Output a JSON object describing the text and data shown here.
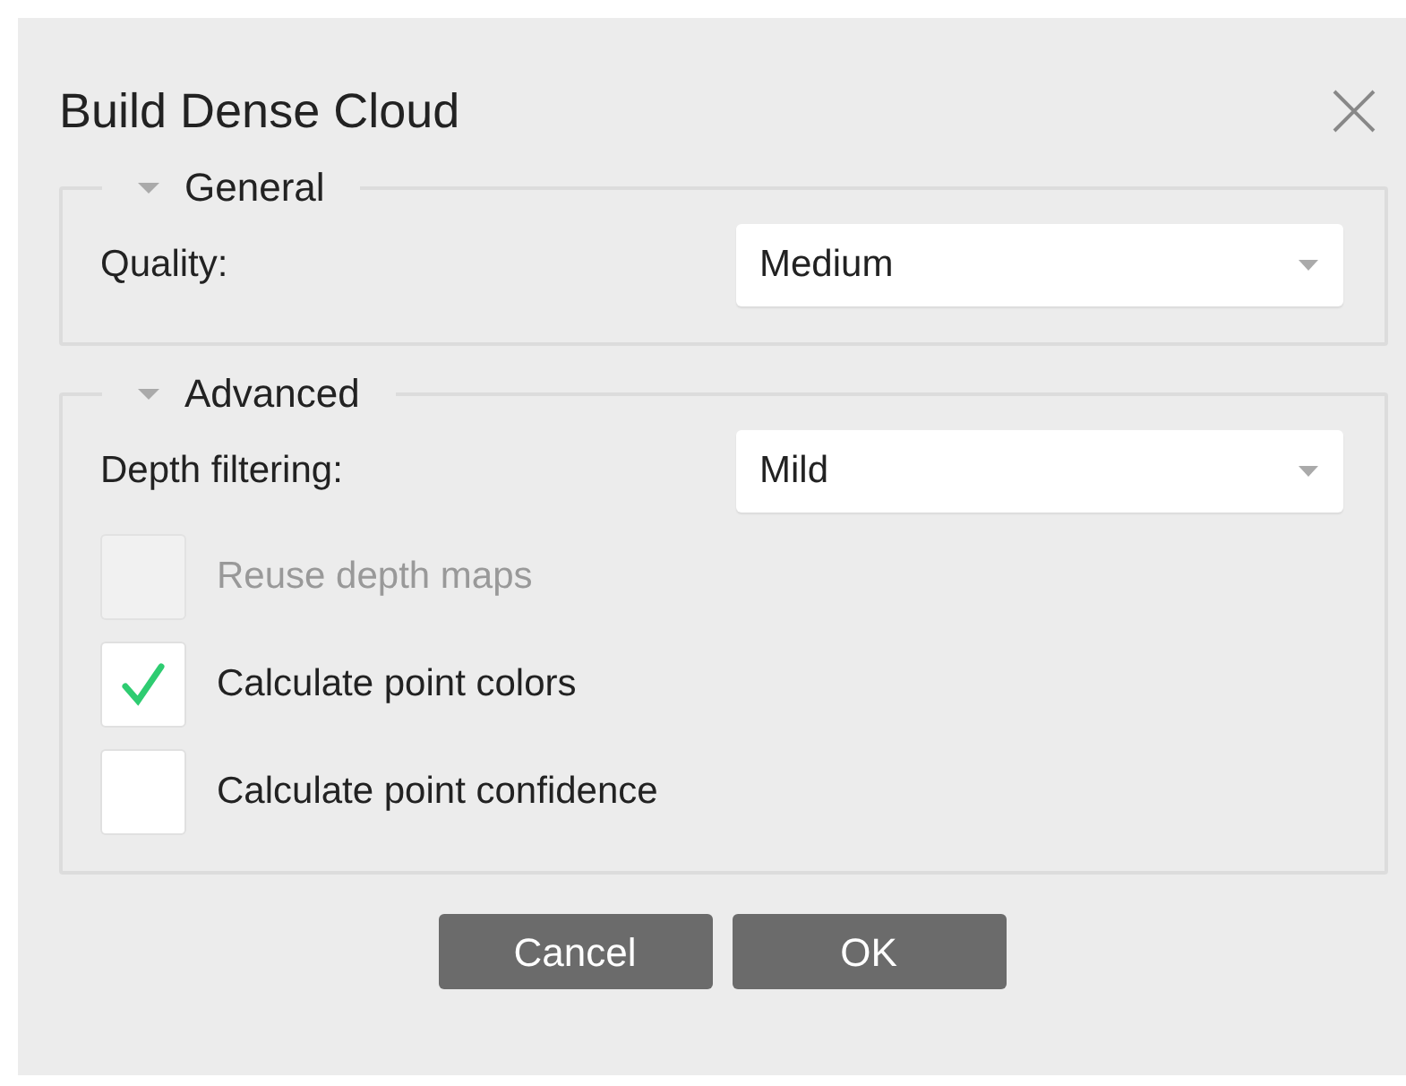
{
  "window": {
    "title": "Build Dense Cloud"
  },
  "groups": [
    {
      "title": "General",
      "expanded": true,
      "rows": [
        {
          "kind": "combo",
          "label": "Quality:",
          "value": "Medium"
        }
      ]
    },
    {
      "title": "Advanced",
      "expanded": true,
      "rows": [
        {
          "kind": "combo",
          "label": "Depth filtering:",
          "value": "Mild"
        },
        {
          "kind": "checkbox",
          "label": "Reuse depth maps",
          "checked": false,
          "disabled": true
        },
        {
          "kind": "checkbox",
          "label": "Calculate point colors",
          "checked": true,
          "disabled": false
        },
        {
          "kind": "checkbox",
          "label": "Calculate point confidence",
          "checked": false,
          "disabled": false
        }
      ]
    }
  ],
  "buttons": [
    "Cancel",
    "OK"
  ]
}
